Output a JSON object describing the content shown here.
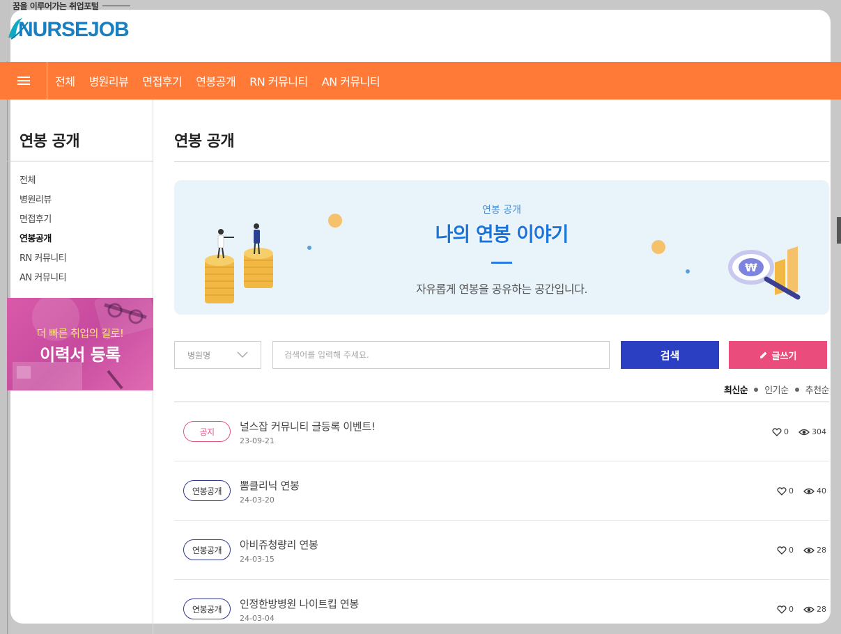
{
  "header": {
    "tagline": "꿈을 이루어가는 취업포털",
    "logo_text": "NURSEJOB"
  },
  "nav": {
    "items": [
      "전체",
      "병원리뷰",
      "면접후기",
      "연봉공개",
      "RN 커뮤니티",
      "AN 커뮤니티"
    ]
  },
  "sidebar": {
    "title": "연봉 공개",
    "items": [
      {
        "label": "전체",
        "active": false
      },
      {
        "label": "병원리뷰",
        "active": false
      },
      {
        "label": "면접후기",
        "active": false
      },
      {
        "label": "연봉공개",
        "active": true
      },
      {
        "label": "RN 커뮤니티",
        "active": false
      },
      {
        "label": "AN 커뮤니티",
        "active": false
      }
    ],
    "promo": {
      "subtitle": "더 빠른 취업의 길로!",
      "title": "이력서 등록"
    }
  },
  "main": {
    "title": "연봉 공개",
    "banner": {
      "subtitle": "연봉 공개",
      "title": "나의 연봉 이야기",
      "description": "자유롭게 연봉을 공유하는 공간입니다."
    },
    "search": {
      "select_label": "병원명",
      "placeholder": "검색어를 입력해 주세요.",
      "search_label": "검색",
      "write_label": "글쓰기"
    },
    "sort": {
      "options": [
        "최신순",
        "인기순",
        "추천순"
      ],
      "active": "최신순"
    },
    "posts": [
      {
        "badge": "공지",
        "type": "notice",
        "title": "널스잡 커뮤니티 글등록 이벤트!",
        "date": "23-09-21",
        "likes": "0",
        "views": "304"
      },
      {
        "badge": "연봉공개",
        "type": "normal",
        "title": "뽐클리닉 연봉",
        "date": "24-03-20",
        "likes": "0",
        "views": "40"
      },
      {
        "badge": "연봉공개",
        "type": "normal",
        "title": "아비쥬청량리 연봉",
        "date": "24-03-15",
        "likes": "0",
        "views": "28"
      },
      {
        "badge": "연봉공개",
        "type": "normal",
        "title": "인정한방병원 나이트킵 연봉",
        "date": "24-03-04",
        "likes": "0",
        "views": "28"
      }
    ]
  },
  "colors": {
    "nav_bg": "#ff7a36",
    "search_btn": "#2b3fc2",
    "write_btn": "#ea4d7c",
    "banner_bg": "#e8f3fa",
    "banner_title": "#1a73d9"
  }
}
